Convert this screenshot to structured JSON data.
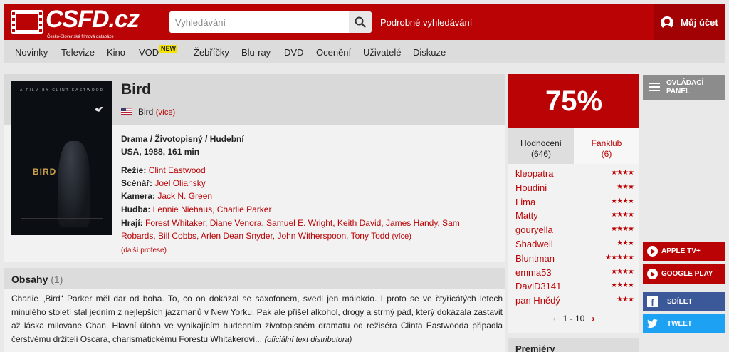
{
  "header": {
    "logo_text": "CSFD.cz",
    "logo_tagline": "Česko-Slovenská filmová databáze",
    "search_placeholder": "Vyhledávání",
    "advanced_search": "Podrobné vyhledávání",
    "account": "Můj účet"
  },
  "nav": {
    "items": [
      "Novinky",
      "Televize",
      "Kino",
      "VOD",
      "Žebříčky",
      "Blu-ray",
      "DVD",
      "Ocenění",
      "Uživatelé",
      "Diskuze"
    ],
    "vod_badge": "NEW"
  },
  "film": {
    "title": "Bird",
    "alt_title": "Bird",
    "alt_more": "(více)",
    "genres": "Drama / Životopisný / Hudební",
    "origin": "USA, 1988, 161 min",
    "poster": {
      "tagline": "A FILM BY CLINT EASTWOOD",
      "title": "BIRD"
    },
    "crew": {
      "directing_label": "Režie:",
      "directing": "Clint Eastwood",
      "writing_label": "Scénář:",
      "writing": "Joel Oliansky",
      "camera_label": "Kamera:",
      "camera": "Jack N. Green",
      "music_label": "Hudba:",
      "music_1": "Lennie Niehaus",
      "music_sep": ", ",
      "music_2": "Charlie Parker",
      "cast_label": "Hrají:",
      "cast_line1": "Forest Whitaker, Diane Venora, Samuel E. Wright, Keith David, James Handy, Sam",
      "cast_line2": "Robards, Bill Cobbs, Arlen Dean Snyder, John Witherspoon, Tony Todd",
      "cast_more": "(více)",
      "more_professions": "(další profese)"
    }
  },
  "synopsis": {
    "title": "Obsahy",
    "count": "(1)",
    "text": "Charlie „Bird“ Parker měl dar od boha. To, co on dokázal se saxofonem, svedl jen málokdo. I proto se ve čtyřicátých letech minulého století stal jedním z nejlepších jazzmanů v New Yorku. Pak ale přišel alkohol, drogy a strmý pád, který dokázala zastavit až láska milované Chan. Hlavní úloha ve vynikajícím hudebním životopisném dramatu od režiséra Clinta Eastwooda připadla čerstvému držiteli Oscara, charismatickému Forestu Whitakerovi...",
    "source": "(oficiální text distributora)"
  },
  "rating": {
    "score": "75%",
    "tab_ratings": "Hodnocení",
    "tab_ratings_count": "(646)",
    "tab_fanclub": "Fanklub",
    "tab_fanclub_count": "(6)",
    "raters": [
      {
        "name": "kleopatra",
        "stars": 4
      },
      {
        "name": "Houdini",
        "stars": 3
      },
      {
        "name": "Lima",
        "stars": 4
      },
      {
        "name": "Matty",
        "stars": 4
      },
      {
        "name": "gouryella",
        "stars": 4
      },
      {
        "name": "Shadwell",
        "stars": 3
      },
      {
        "name": "Bluntman",
        "stars": 5
      },
      {
        "name": "emma53",
        "stars": 4
      },
      {
        "name": "DaviD3141",
        "stars": 4
      },
      {
        "name": "pan Hnědý",
        "stars": 3
      }
    ],
    "pager": "1 - 10",
    "pager_prev": "‹",
    "pager_next": "›",
    "premiery": "Premiéry"
  },
  "sidebar": {
    "control_panel": "OVLÁDACÍ PANEL",
    "apple_tv": "APPLE TV+",
    "google_play": "GOOGLE PLAY",
    "share": "SDÍLET",
    "tweet": "TWEET",
    "fb_letter": "f"
  },
  "colors": {
    "brand_red": "#ba0305",
    "facebook": "#3b5998",
    "twitter": "#1da1f2",
    "control_gray": "#8c8c8c"
  }
}
